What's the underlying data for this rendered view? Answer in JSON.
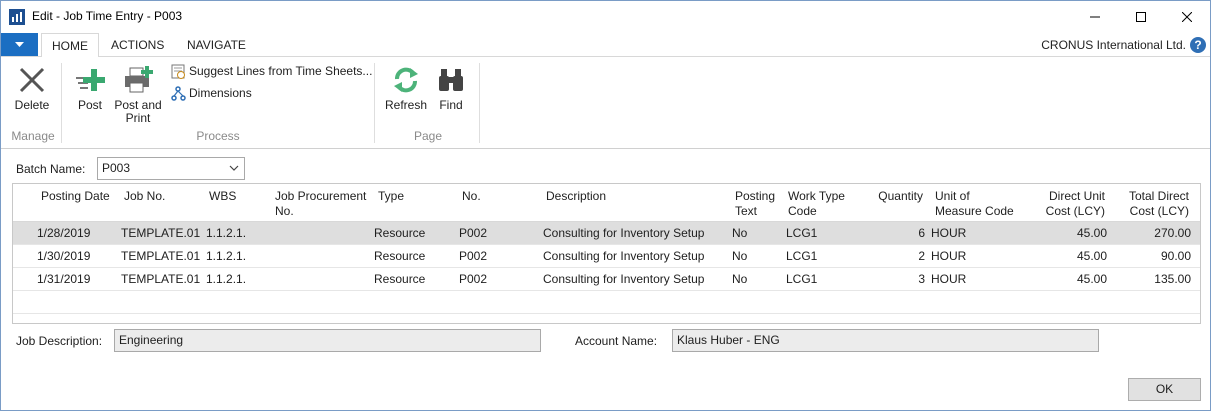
{
  "window": {
    "title": "Edit - Job Time Entry - P003"
  },
  "tabs": {
    "home": "HOME",
    "actions": "ACTIONS",
    "navigate": "NAVIGATE"
  },
  "company": "CRONUS International Ltd.",
  "help_label": "?",
  "ribbon": {
    "delete": "Delete",
    "post": "Post",
    "post_and_print_1": "Post and",
    "post_and_print_2": "Print",
    "suggest_lines": "Suggest Lines from Time Sheets...",
    "dimensions": "Dimensions",
    "refresh": "Refresh",
    "find": "Find",
    "group_manage": "Manage",
    "group_process": "Process",
    "group_page": "Page"
  },
  "batch": {
    "label": "Batch Name:",
    "value": "P003"
  },
  "grid": {
    "headers": {
      "posting_date": "Posting Date",
      "job_no": "Job No.",
      "wbs": "WBS",
      "job_procurement_1": "Job Procurement",
      "job_procurement_2": "No.",
      "type": "Type",
      "no": "No.",
      "description": "Description",
      "posting_text_1": "Posting",
      "posting_text_2": "Text",
      "work_type_1": "Work Type",
      "work_type_2": "Code",
      "quantity": "Quantity",
      "uom_1": "Unit of",
      "uom_2": "Measure Code",
      "direct_unit_1": "Direct Unit",
      "direct_unit_2": "Cost (LCY)",
      "total_direct_1": "Total Direct",
      "total_direct_2": "Cost (LCY)"
    },
    "rows": [
      {
        "posting_date": "1/28/2019",
        "job_no": "TEMPLATE.01",
        "wbs": "1.1.2.1.",
        "type": "Resource",
        "no": "P002",
        "description": "Consulting for Inventory Setup",
        "posting_text": "No",
        "work_type": "LCG1",
        "quantity": "6",
        "uom": "HOUR",
        "direct_unit_cost": "45.00",
        "total_direct_cost": "270.00"
      },
      {
        "posting_date": "1/30/2019",
        "job_no": "TEMPLATE.01",
        "wbs": "1.1.2.1.",
        "type": "Resource",
        "no": "P002",
        "description": "Consulting for Inventory Setup",
        "posting_text": "No",
        "work_type": "LCG1",
        "quantity": "2",
        "uom": "HOUR",
        "direct_unit_cost": "45.00",
        "total_direct_cost": "90.00"
      },
      {
        "posting_date": "1/31/2019",
        "job_no": "TEMPLATE.01",
        "wbs": "1.1.2.1.",
        "type": "Resource",
        "no": "P002",
        "description": "Consulting for Inventory Setup",
        "posting_text": "No",
        "work_type": "LCG1",
        "quantity": "3",
        "uom": "HOUR",
        "direct_unit_cost": "45.00",
        "total_direct_cost": "135.00"
      }
    ]
  },
  "footer": {
    "job_description_label": "Job Description:",
    "job_description_value": "Engineering",
    "account_name_label": "Account Name:",
    "account_name_value": "Klaus Huber - ENG"
  },
  "ok_label": "OK",
  "colors": {
    "accent": "#1b6ec2",
    "selected_row": "#dedede",
    "post_icon": "#3aa870",
    "refresh_icon": "#4db37a"
  }
}
